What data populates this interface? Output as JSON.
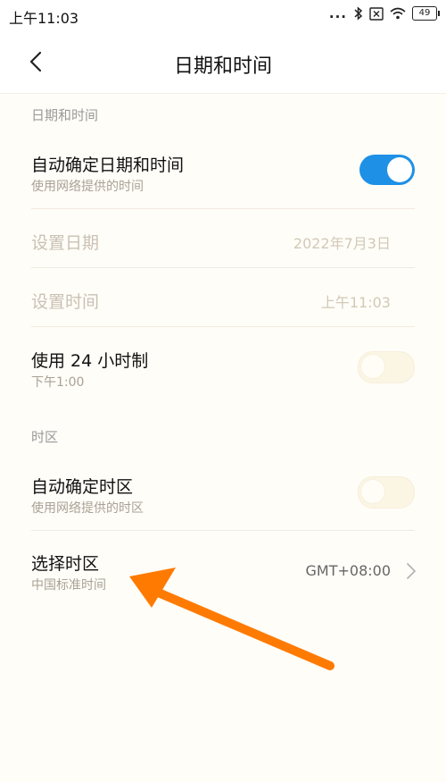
{
  "status_bar": {
    "time": "上午11:03",
    "dots": "...",
    "battery": "49"
  },
  "header": {
    "title": "日期和时间"
  },
  "sections": {
    "datetime": {
      "header": "日期和时间",
      "auto_datetime": {
        "title": "自动确定日期和时间",
        "subtitle": "使用网络提供的时间",
        "enabled": true
      },
      "set_date": {
        "title": "设置日期",
        "value": "2022年7月3日"
      },
      "set_time": {
        "title": "设置时间",
        "value": "上午11:03"
      },
      "use_24h": {
        "title": "使用 24 小时制",
        "subtitle": "下午1:00",
        "enabled": false
      }
    },
    "timezone": {
      "header": "时区",
      "auto_timezone": {
        "title": "自动确定时区",
        "subtitle": "使用网络提供的时区",
        "enabled": false
      },
      "select_timezone": {
        "title": "选择时区",
        "subtitle": "中国标准时间",
        "value": "GMT+08:00"
      }
    }
  },
  "colors": {
    "accent": "#1e90e6",
    "arrow": "#ff7a00"
  },
  "icons": [
    "bluetooth-icon",
    "close-box-icon",
    "wifi-icon",
    "battery-icon",
    "back-icon",
    "chevron-right-icon"
  ]
}
